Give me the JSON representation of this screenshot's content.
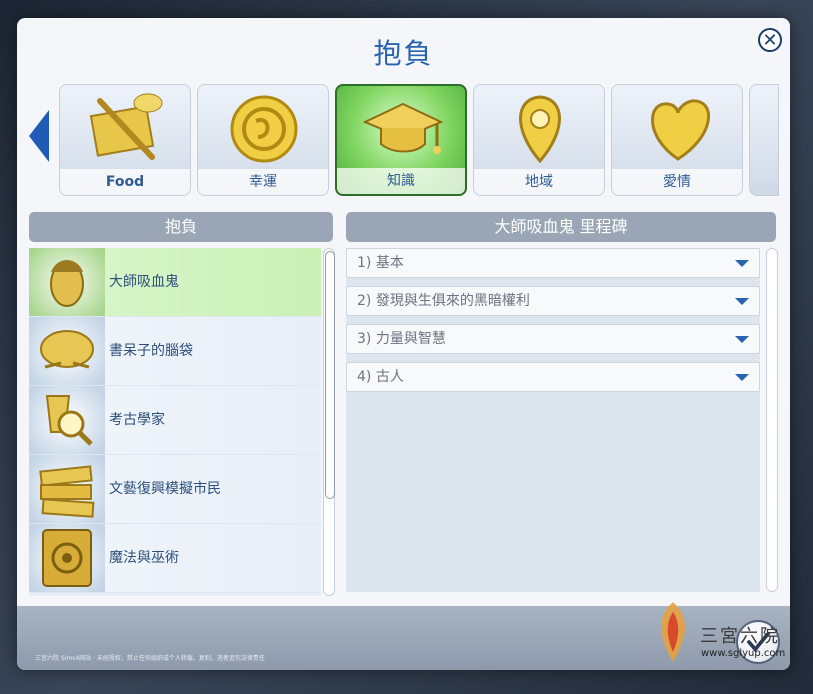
{
  "dialog": {
    "title": "抱負",
    "close_symbol": "✕"
  },
  "categories": [
    {
      "label": "Food",
      "icon": "food-icon",
      "selected": false
    },
    {
      "label": "幸運",
      "icon": "coin-icon",
      "selected": false
    },
    {
      "label": "知識",
      "icon": "graduation-cap-icon",
      "selected": true
    },
    {
      "label": "地域",
      "icon": "map-pin-icon",
      "selected": false
    },
    {
      "label": "愛情",
      "icon": "heart-icon",
      "selected": false
    }
  ],
  "left_panel": {
    "header": "抱負",
    "items": [
      {
        "label": "大師吸血鬼",
        "icon": "vampire-face-icon",
        "selected": true
      },
      {
        "label": "書呆子的腦袋",
        "icon": "brain-icon",
        "selected": false
      },
      {
        "label": "考古學家",
        "icon": "magnifier-icon",
        "selected": false
      },
      {
        "label": "文藝復興模擬市民",
        "icon": "books-icon",
        "selected": false
      },
      {
        "label": "魔法與巫術",
        "icon": "spellbook-icon",
        "selected": false
      }
    ]
  },
  "right_panel": {
    "header": "大師吸血鬼 里程碑",
    "milestones": [
      {
        "label": "1) 基本"
      },
      {
        "label": "2) 發現與生俱來的黑暗權利"
      },
      {
        "label": "3) 力量與智慧"
      },
      {
        "label": "4) 古人"
      }
    ]
  },
  "footer": {
    "note": "三宫六院 Sims4网站 · 未经授权，禁止任何组织或个人转载、复制，违者追究法律责任"
  },
  "watermark": {
    "text": "三宮六院",
    "url": "www.sglyup.com"
  },
  "colors": {
    "accent": "#2a63b0",
    "selected_green": "#7fd45f",
    "header_gray": "#9aa6b5"
  }
}
